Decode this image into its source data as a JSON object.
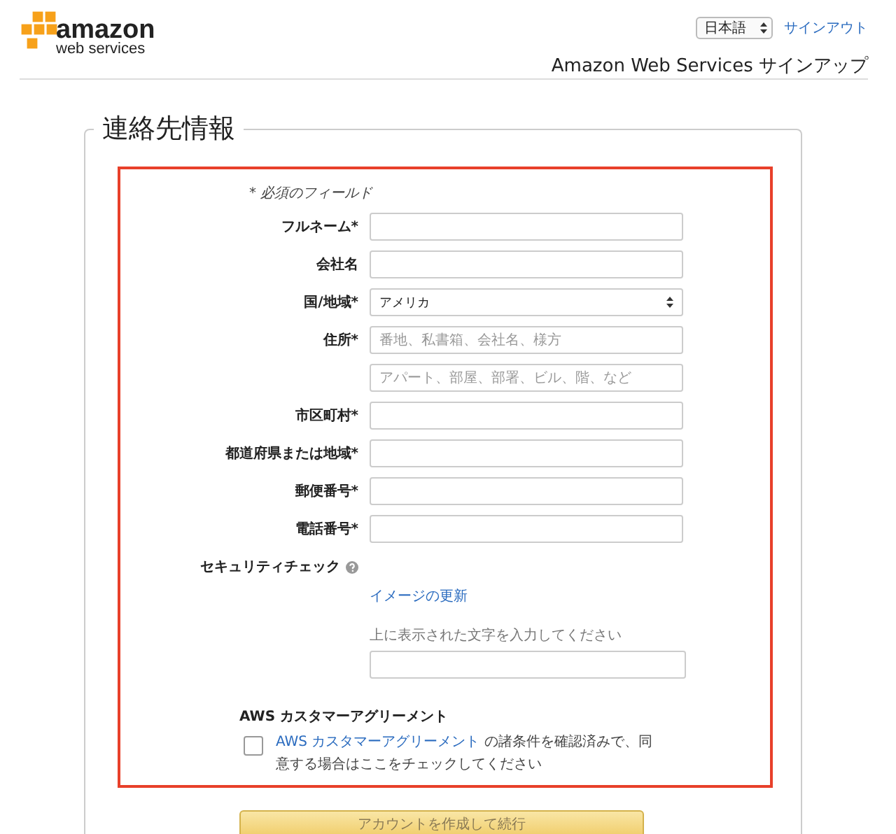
{
  "header": {
    "logo_name": "amazon",
    "logo_sub": "web services",
    "language": "日本語",
    "signout": "サインアウト",
    "title": "Amazon Web Services サインアップ"
  },
  "section": {
    "legend": "連絡先情報",
    "required_note": "* 必須のフィールド",
    "fields": [
      {
        "kind": "input",
        "label": "フルネーム*"
      },
      {
        "kind": "input",
        "label": "会社名"
      },
      {
        "kind": "select",
        "label": "国/地域*",
        "value": "アメリカ"
      },
      {
        "kind": "input",
        "label": "住所*",
        "placeholder": "番地、私書箱、会社名、様方"
      },
      {
        "kind": "input",
        "placeholder": "アパート、部屋、部署、ビル、階、など"
      },
      {
        "kind": "input",
        "label": "市区町村*"
      },
      {
        "kind": "input",
        "label": "都道府県または地域*"
      },
      {
        "kind": "input",
        "label": "郵便番号*"
      },
      {
        "kind": "input",
        "label": "電話番号*"
      }
    ],
    "security": {
      "label": "セキュリティチェック",
      "refresh_link": "イメージの更新",
      "caption": "上に表示された文字を入力してください"
    },
    "agreement": {
      "heading": "AWS カスタマーアグリーメント",
      "checked": false,
      "link": "AWS カスタマーアグリーメント",
      "text": " の諸条件を確認済みで、同意する場合はここをチェックしてください"
    }
  },
  "submit": "アカウントを作成して続行"
}
